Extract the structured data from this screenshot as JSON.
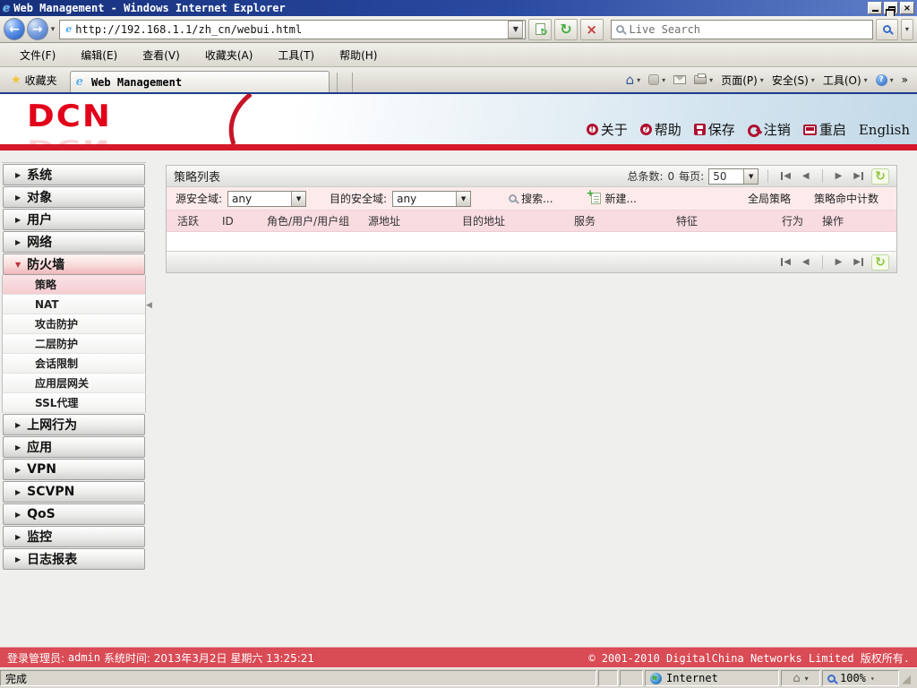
{
  "window": {
    "title": "Web Management - Windows Internet Explorer"
  },
  "nav": {
    "url": "http://192.168.1.1/zh_cn/webui.html",
    "search_placeholder": "Live Search"
  },
  "menus": [
    "文件(F)",
    "编辑(E)",
    "查看(V)",
    "收藏夹(A)",
    "工具(T)",
    "帮助(H)"
  ],
  "favbar": {
    "favorites": "收藏夹",
    "tab": "Web Management",
    "page_menu": "页面(P)",
    "safety_menu": "安全(S)",
    "tools_menu": "工具(O)"
  },
  "header": {
    "logo": "DCN",
    "about": "关于",
    "help": "帮助",
    "save": "保存",
    "logout": "注销",
    "reboot": "重启",
    "lang": "English"
  },
  "sidebar": {
    "top_items": [
      "系统",
      "对象",
      "用户",
      "网络"
    ],
    "expanded_item": "防火墙",
    "sub_items": [
      "策略",
      "NAT",
      "攻击防护",
      "二层防护",
      "会话限制",
      "应用层网关",
      "SSL代理"
    ],
    "selected_sub": "策略",
    "bottom_items": [
      "上网行为",
      "应用",
      "VPN",
      "SCVPN",
      "QoS",
      "监控",
      "日志报表"
    ]
  },
  "list": {
    "title": "策略列表"
  },
  "pager": {
    "total_label": "总条数:",
    "total": "0",
    "per_page_label": "每页:",
    "per_page": "50"
  },
  "filters": {
    "src_zone_label": "源安全域:",
    "src_zone_value": "any",
    "dst_zone_label": "目的安全域:",
    "dst_zone_value": "any",
    "search_label": "搜索...",
    "new_label": "新建...",
    "global_policy": "全局策略",
    "hit_count": "策略命中计数"
  },
  "table": {
    "headers": [
      "活跃",
      "ID",
      "角色/用户/用户组",
      "源地址",
      "目的地址",
      "服务",
      "特征",
      "行为",
      "操作"
    ]
  },
  "page_status": {
    "login_label": "登录管理员:",
    "login_user": "admin",
    "time_label": "系统时间:",
    "time_value": "2013年3月2日 星期六 13:25:21",
    "copyright": "© 2001-2010 DigitalChina Networks Limited 版权所有."
  },
  "browser_status": {
    "state": "完成",
    "zone": "Internet",
    "zoom": "100%"
  },
  "glyphs": {
    "back": "←",
    "forward": "→",
    "down": "▼",
    "down_small": "▾",
    "right_tri": "▶",
    "down_tri": "▼",
    "prev": "◀",
    "next": "▶",
    "refresh": "↻",
    "stop": "×",
    "close": "×",
    "home": "⌂",
    "more": "»",
    "star": "★",
    "q": "?",
    "excl": "!",
    "ie": "e",
    "grip": "◢"
  },
  "colors": {
    "brand_red": "#e2001a",
    "bar_red": "#d6182b",
    "status_red": "#d94b55",
    "title_blue": "#1c3b8e"
  }
}
